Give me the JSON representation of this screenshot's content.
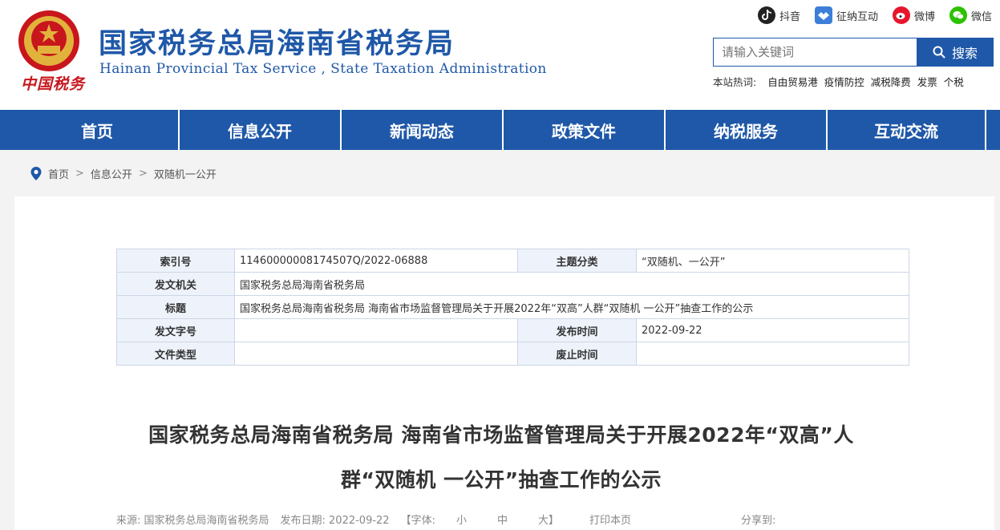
{
  "header": {
    "title_cn": "国家税务总局海南省税务局",
    "title_en": "Hainan Provincial Tax Service , State Taxation Administration",
    "brand_script": "中国税务"
  },
  "social": [
    {
      "label": "抖音",
      "icon": "douyin-icon"
    },
    {
      "label": "征纳互动",
      "icon": "interaction-icon"
    },
    {
      "label": "微博",
      "icon": "weibo-icon"
    },
    {
      "label": "微信",
      "icon": "wechat-icon"
    }
  ],
  "search": {
    "placeholder": "请输入关键词",
    "button": "搜索"
  },
  "hot": {
    "label": "本站热词:",
    "words": [
      "自由贸易港",
      "疫情防控",
      "减税降费",
      "发票",
      "个税"
    ]
  },
  "nav": [
    "首页",
    "信息公开",
    "新闻动态",
    "政策文件",
    "纳税服务",
    "互动交流"
  ],
  "breadcrumb": [
    "首页",
    "信息公开",
    "双随机一公开"
  ],
  "meta_table": {
    "index_label": "索引号",
    "index_value": "11460000008174507Q/2022-06888",
    "topic_label": "主题分类",
    "topic_value": "“双随机、一公开”",
    "issuer_label": "发文机关",
    "issuer_value": "国家税务总局海南省税务局",
    "title_label": "标题",
    "title_value": "国家税务总局海南省税务局 海南省市场监督管理局关于开展2022年“双高”人群“双随机 一公开”抽查工作的公示",
    "docno_label": "发文字号",
    "docno_value": "",
    "pubdate_label": "发布时间",
    "pubdate_value": "2022-09-22",
    "doctype_label": "文件类型",
    "doctype_value": "",
    "expire_label": "废止时间",
    "expire_value": ""
  },
  "article": {
    "title_line1": "国家税务总局海南省税务局 海南省市场监督管理局关于开展2022年“双高”人",
    "title_line2": "群“双随机 一公开”抽查工作的公示",
    "source": "来源:  国家税务总局海南省税务局",
    "date": "发布日期:  2022-09-22",
    "font_label": "【字体:",
    "font_small": "小",
    "font_medium": "中",
    "font_large": "大】",
    "print": "打印本页",
    "share": "分享到:"
  },
  "colors": {
    "brand_blue": "#1f58a8",
    "emblem_red": "#c8161d",
    "gold": "#e2b33c"
  }
}
